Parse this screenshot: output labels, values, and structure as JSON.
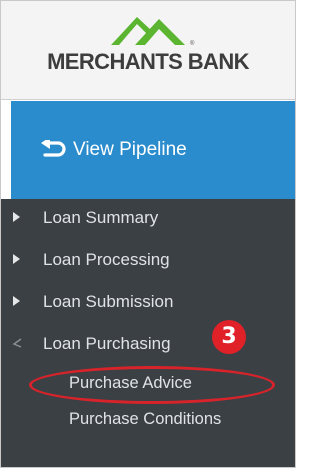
{
  "brand": {
    "name": "MERCHANTS BANK",
    "registered_mark": "®",
    "colors": {
      "logo_green": "#5bb531",
      "logo_text": "#3d3d3d"
    }
  },
  "pipeline_button": {
    "label": "View Pipeline",
    "icon": "return-arrow-icon",
    "background": "#2a8ccd"
  },
  "nav": {
    "items": [
      {
        "label": "Loan Summary",
        "icon": "caret-right-icon",
        "expanded": false
      },
      {
        "label": "Loan Processing",
        "icon": "caret-right-icon",
        "expanded": false
      },
      {
        "label": "Loan Submission",
        "icon": "caret-right-icon",
        "expanded": false
      },
      {
        "label": "Loan Purchasing",
        "icon": "chevron-collapse-icon",
        "expanded": true,
        "children": [
          {
            "label": "Purchase Advice",
            "highlighted": true
          },
          {
            "label": "Purchase Conditions",
            "highlighted": false
          }
        ]
      }
    ]
  },
  "annotation": {
    "step_number": "3",
    "color": "#e02128"
  }
}
